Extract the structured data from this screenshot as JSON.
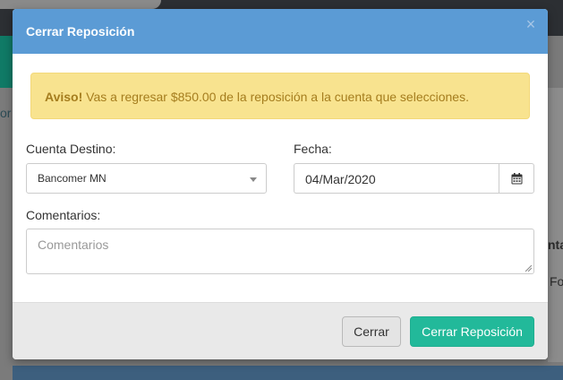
{
  "background": {
    "side_text": "or",
    "right_text_1": "nta",
    "right_text_2": "Fo"
  },
  "modal": {
    "title": "Cerrar Reposición",
    "close_symbol": "×",
    "alert": {
      "strong": "Aviso!",
      "message": " Vas a regresar $850.00 de la reposición a la cuenta que selecciones."
    },
    "account": {
      "label": "Cuenta Destino:",
      "value": "Bancomer MN"
    },
    "date": {
      "label": "Fecha:",
      "value": "04/Mar/2020",
      "icon": "calendar-icon"
    },
    "comments": {
      "label": "Comentarios:",
      "placeholder": "Comentarios"
    },
    "footer": {
      "cancel_label": "Cerrar",
      "confirm_label": "Cerrar Reposición"
    }
  },
  "colors": {
    "header_blue": "#5b9bd5",
    "alert_bg": "#f8e38f",
    "alert_text": "#a57d1e",
    "primary_green": "#22b99a"
  }
}
